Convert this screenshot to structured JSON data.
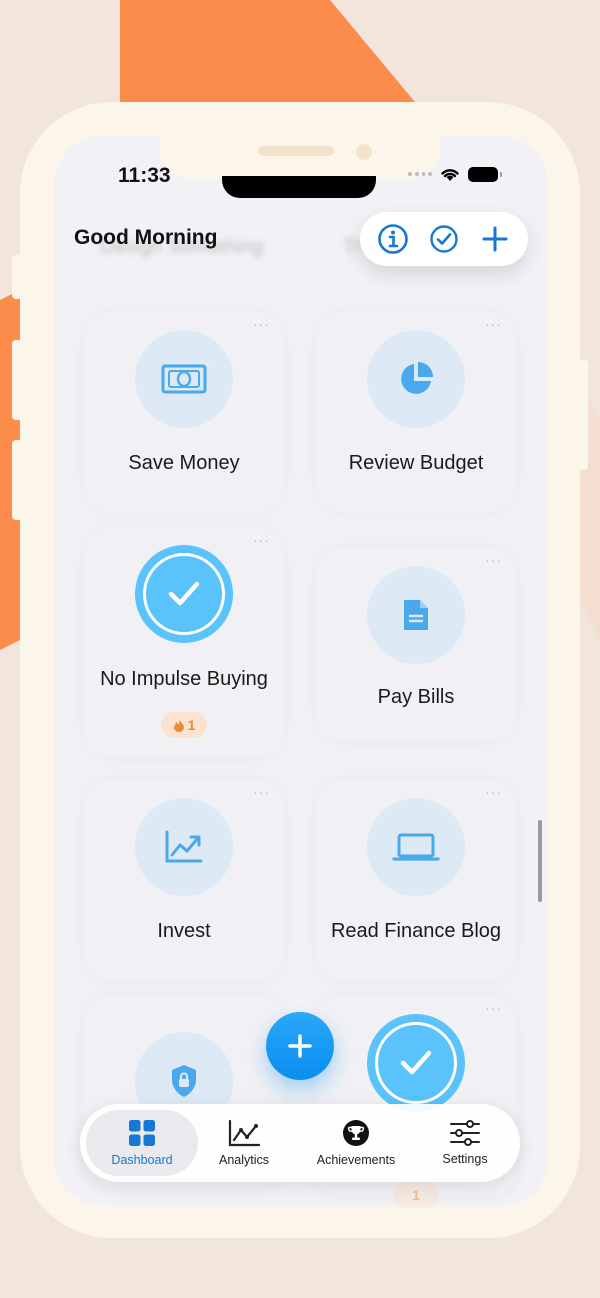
{
  "status_bar": {
    "time": "11:33"
  },
  "header": {
    "greeting": "Good Morning",
    "faded_titles": [
      "Design Something",
      "Tr"
    ],
    "actions": [
      {
        "name": "info",
        "icon": "info-circle-icon"
      },
      {
        "name": "check",
        "icon": "check-circle-icon"
      },
      {
        "name": "add",
        "icon": "plus-icon"
      }
    ]
  },
  "habits": [
    {
      "label": "Save Money",
      "icon": "banknote-icon",
      "completed": false
    },
    {
      "label": "Review Budget",
      "icon": "pie-chart-icon",
      "completed": false
    },
    {
      "label": "No Impulse Buying",
      "icon": "checkmark-icon",
      "completed": true,
      "streak": "1"
    },
    {
      "label": "Pay Bills",
      "icon": "document-icon",
      "completed": false
    },
    {
      "label": "Invest",
      "icon": "trend-chart-icon",
      "completed": false
    },
    {
      "label": "Read Finance Blog",
      "icon": "laptop-icon",
      "completed": false
    },
    {
      "label": "",
      "icon": "shield-lock-icon",
      "completed": false
    },
    {
      "label": "",
      "icon": "checkmark-icon",
      "completed": true,
      "streak": "1"
    }
  ],
  "menu_glyph": "···",
  "streak_icon": "flame-icon",
  "tabbar": {
    "tabs": [
      {
        "label": "Dashboard",
        "icon": "grid-icon",
        "active": true
      },
      {
        "label": "Analytics",
        "icon": "line-chart-icon",
        "active": false
      },
      {
        "label": "Achievements",
        "icon": "trophy-icon",
        "active": false
      },
      {
        "label": "Settings",
        "icon": "sliders-icon",
        "active": false
      }
    ]
  },
  "colors": {
    "accent": "#0a8ef0",
    "completed": "#5ac3fb",
    "icon_bg": "#dde9f4",
    "streak_bg": "#fbe3cf",
    "streak_text": "#e98a3a",
    "background": "#f2e6dc",
    "bg_shape": "#fc8c4c",
    "frame": "#fcf6ea"
  }
}
